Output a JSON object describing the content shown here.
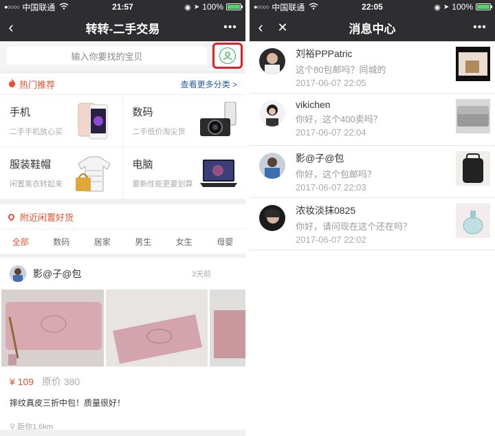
{
  "left": {
    "status": {
      "signal": "●○○○○",
      "carrier": "中国联通",
      "time": "21:57",
      "battery": "100%"
    },
    "nav": {
      "back": "‹",
      "title": "转转-二手交易",
      "more": "•••"
    },
    "search": {
      "placeholder": "输入你要找的宝贝"
    },
    "hot": {
      "title": "热门推荐",
      "more": "查看更多分类 >"
    },
    "categories": [
      {
        "name": "手机",
        "sub": "二手手机放心买"
      },
      {
        "name": "数码",
        "sub": "二手低价淘尖货"
      },
      {
        "name": "服装鞋帽",
        "sub": "闲置美衣转起来"
      },
      {
        "name": "电脑",
        "sub": "要新性能更要划算"
      }
    ],
    "nearby": {
      "title": "附近闲置好货"
    },
    "filters": [
      "全部",
      "数码",
      "居家",
      "男生",
      "女生",
      "母婴"
    ],
    "post": {
      "user": "影@子@包",
      "time": "3天前",
      "price": "¥ 109",
      "original": "原价 380",
      "desc": "摔纹真皮三折中包！质量很好！",
      "distance": "距你1.6km"
    }
  },
  "right": {
    "status": {
      "signal": "●○○○○",
      "carrier": "中国联通",
      "time": "22:05",
      "battery": "100%"
    },
    "nav": {
      "back": "‹",
      "close": "✕",
      "title": "消息中心",
      "more": "•••"
    },
    "messages": [
      {
        "name": "刘裕PPPatric",
        "text": "这个80包邮吗？同城的",
        "date": "2017-06-07 22:05"
      },
      {
        "name": "vikichen",
        "text": "你好，这个400卖吗？",
        "date": "2017-06-07 22:04"
      },
      {
        "name": "影@子@包",
        "text": "你好，这个包邮吗？",
        "date": "2017-06-07 22:03"
      },
      {
        "name": "浓妆淡抹0825",
        "text": "你好，请问现在这个还在吗？",
        "date": "2017-06-07 22:02"
      }
    ]
  },
  "colors": {
    "navbar": "#2e2e30",
    "accent": "#e9512f",
    "link": "#2a5fa8",
    "highlight": "#e0202a",
    "profile": "#2fae4a"
  }
}
